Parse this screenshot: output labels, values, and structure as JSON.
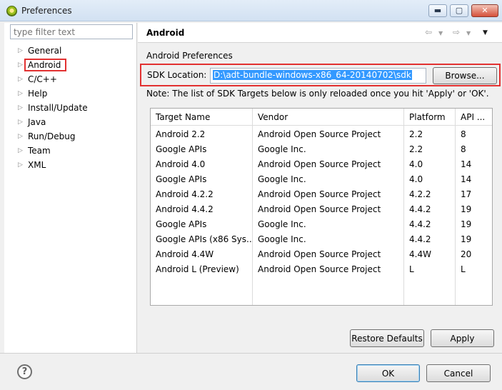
{
  "window": {
    "title": "Preferences",
    "minimize_glyph": "▬",
    "maximize_glyph": "▢",
    "close_glyph": "✕"
  },
  "sidebar": {
    "filter_placeholder": "type filter text",
    "items": [
      {
        "label": "General"
      },
      {
        "label": "Android",
        "selected": true
      },
      {
        "label": "C/C++"
      },
      {
        "label": "Help"
      },
      {
        "label": "Install/Update"
      },
      {
        "label": "Java"
      },
      {
        "label": "Run/Debug"
      },
      {
        "label": "Team"
      },
      {
        "label": "XML"
      }
    ]
  },
  "page": {
    "title": "Android",
    "section_label": "Android Preferences",
    "sdk_label": "SDK Location:",
    "sdk_path": "D:\\adt-bundle-windows-x86_64-20140702\\sdk",
    "browse_label": "Browse...",
    "note": "Note: The list of SDK Targets below is only reloaded once you hit 'Apply' or 'OK'.",
    "restore_label": "Restore Defaults",
    "apply_label": "Apply"
  },
  "targets": {
    "headers": [
      "Target Name",
      "Vendor",
      "Platform",
      "API ..."
    ],
    "rows": [
      [
        "Android 2.2",
        "Android Open Source Project",
        "2.2",
        "8"
      ],
      [
        "Google APIs",
        "Google Inc.",
        "2.2",
        "8"
      ],
      [
        "Android 4.0",
        "Android Open Source Project",
        "4.0",
        "14"
      ],
      [
        "Google APIs",
        "Google Inc.",
        "4.0",
        "14"
      ],
      [
        "Android 4.2.2",
        "Android Open Source Project",
        "4.2.2",
        "17"
      ],
      [
        "Android 4.4.2",
        "Android Open Source Project",
        "4.4.2",
        "19"
      ],
      [
        "Google APIs",
        "Google Inc.",
        "4.4.2",
        "19"
      ],
      [
        "Google APIs (x86 Sys...",
        "Google Inc.",
        "4.4.2",
        "19"
      ],
      [
        "Android 4.4W",
        "Android Open Source Project",
        "4.4W",
        "20"
      ],
      [
        "Android L (Preview)",
        "Android Open Source Project",
        "L",
        "L"
      ]
    ]
  },
  "footer": {
    "help_glyph": "?",
    "ok_label": "OK",
    "cancel_label": "Cancel"
  },
  "colors": {
    "highlight_red": "#e23131",
    "selection_blue": "#3399ff"
  }
}
